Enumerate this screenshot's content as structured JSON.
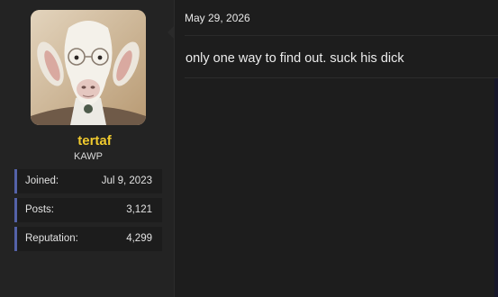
{
  "user": {
    "name": "tertaf",
    "title": "KAWP",
    "stats": [
      {
        "label": "Joined:",
        "value": "Jul 9, 2023"
      },
      {
        "label": "Posts:",
        "value": "3,121"
      },
      {
        "label": "Reputation:",
        "value": "4,299"
      }
    ]
  },
  "post": {
    "date": "May 29, 2026",
    "body": "only one way to find out. suck his dick"
  },
  "colors": {
    "username": "#f0ca2e",
    "stat_accent": "#5462a8",
    "background": "#1d1d1d"
  }
}
